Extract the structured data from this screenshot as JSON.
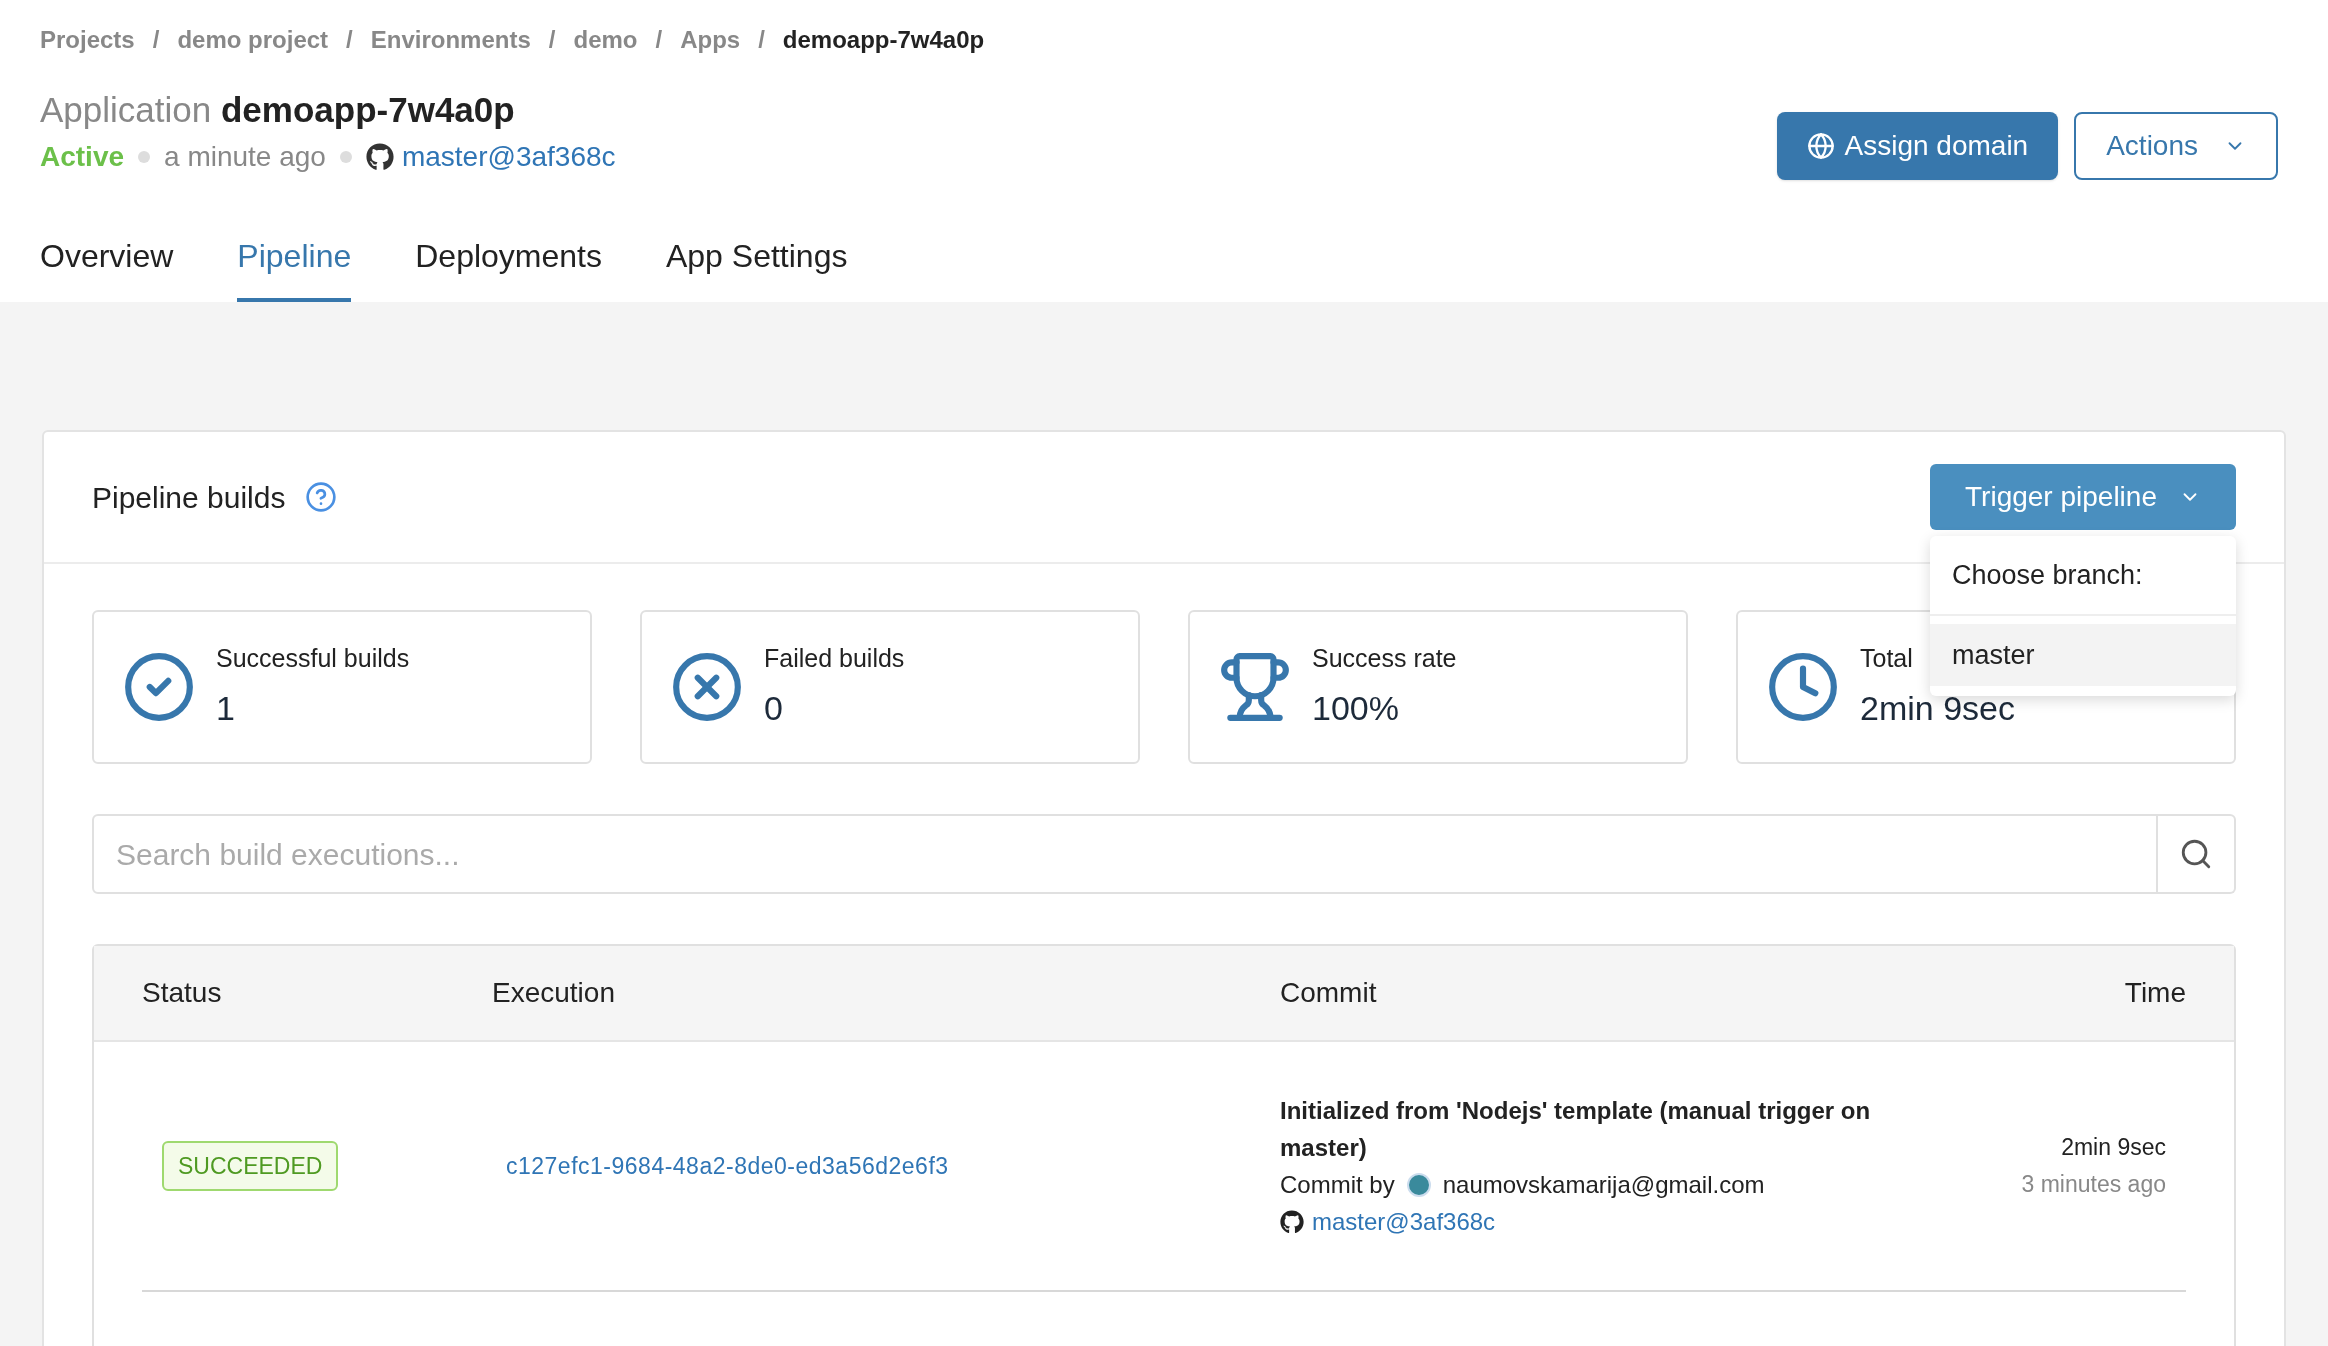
{
  "breadcrumb": [
    {
      "label": "Projects",
      "current": false
    },
    {
      "label": "demo project",
      "current": false
    },
    {
      "label": "Environments",
      "current": false
    },
    {
      "label": "demo",
      "current": false
    },
    {
      "label": "Apps",
      "current": false
    },
    {
      "label": "demoapp-7w4a0p",
      "current": true
    }
  ],
  "breadcrumb_separator": "/",
  "header": {
    "prefix": "Application",
    "name": "demoapp-7w4a0p",
    "status": "Active",
    "updated": "a minute ago",
    "commit": "master@3af368c"
  },
  "header_buttons": [
    {
      "label": "Assign domain",
      "kind": "primary"
    },
    {
      "label": "Actions",
      "kind": "outline"
    }
  ],
  "tabs": [
    {
      "label": "Overview",
      "selected": false
    },
    {
      "label": "Pipeline",
      "selected": true
    },
    {
      "label": "Deployments",
      "selected": false
    },
    {
      "label": "App Settings",
      "selected": false
    }
  ],
  "pipeline": {
    "title": "Pipeline builds",
    "trigger_button": "Trigger pipeline",
    "dropdown": {
      "heading": "Choose branch:",
      "options": [
        {
          "label": "master",
          "highlighted": true
        }
      ]
    },
    "stats": [
      {
        "kind": "success",
        "label": "Successful builds",
        "value": "1"
      },
      {
        "kind": "failed",
        "label": "Failed builds",
        "value": "0"
      },
      {
        "kind": "rate",
        "label": "Success rate",
        "value": "100%"
      },
      {
        "kind": "time",
        "label": "Total",
        "value": "2min 9sec"
      }
    ],
    "search": {
      "placeholder": "Search build executions..."
    },
    "table": {
      "columns": [
        "Status",
        "Execution",
        "Commit",
        "Time"
      ],
      "rows": [
        {
          "status": "SUCCEEDED",
          "execution": "c127efc1-9684-48a2-8de0-ed3a56d2e6f3",
          "commit_message": "Initialized from 'Nodejs' template (manual trigger on master)",
          "commit_by_label": "Commit by",
          "commit_author": "naumovskamarija@gmail.com",
          "commit_ref": "master@3af368c",
          "duration": "2min 9sec",
          "time_ago": "3 minutes ago"
        }
      ]
    }
  }
}
